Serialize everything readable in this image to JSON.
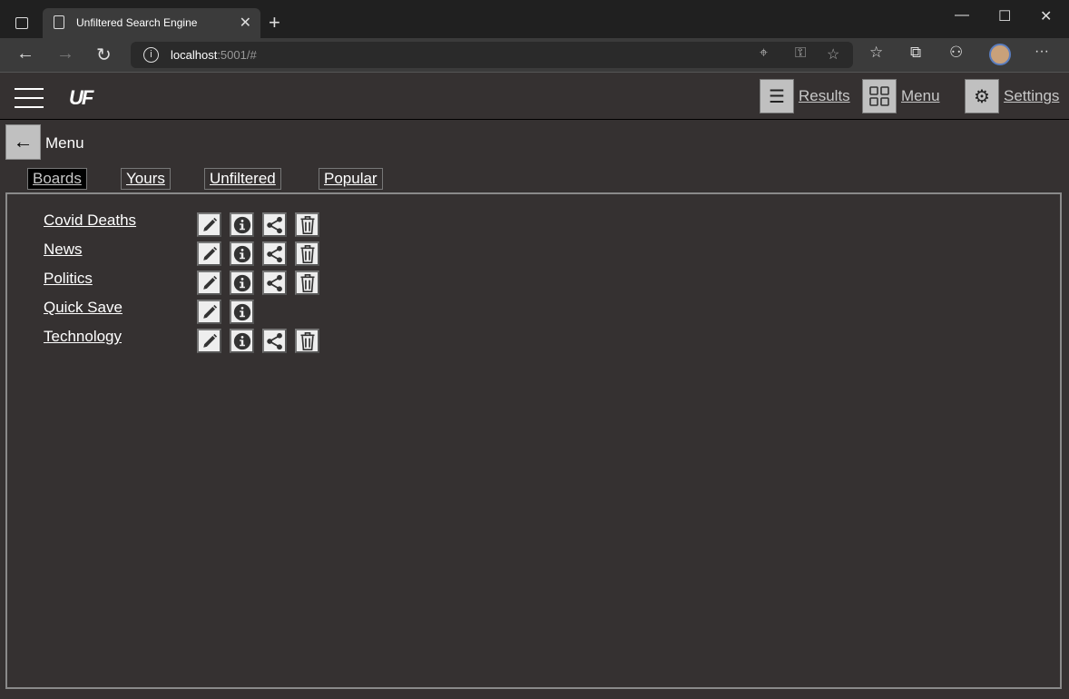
{
  "browser": {
    "tab_title": "Unfiltered Search Engine",
    "url_host": "localhost",
    "url_rest": ":5001/#"
  },
  "header": {
    "logo": "UF",
    "results": "Results",
    "menu": "Menu",
    "settings": "Settings"
  },
  "page": {
    "title": "Menu",
    "tabs": [
      {
        "label": "Boards",
        "active": true
      },
      {
        "label": "Yours"
      },
      {
        "label": "Unfiltered"
      },
      {
        "label": "Popular"
      }
    ]
  },
  "boards": [
    {
      "name": "Covid Deaths",
      "actions": [
        "edit",
        "info",
        "share",
        "delete"
      ]
    },
    {
      "name": "News",
      "actions": [
        "edit",
        "info",
        "share",
        "delete"
      ]
    },
    {
      "name": "Politics",
      "actions": [
        "edit",
        "info",
        "share",
        "delete"
      ]
    },
    {
      "name": "Quick Save",
      "actions": [
        "edit",
        "info"
      ]
    },
    {
      "name": "Technology",
      "actions": [
        "edit",
        "info",
        "share",
        "delete"
      ]
    }
  ]
}
